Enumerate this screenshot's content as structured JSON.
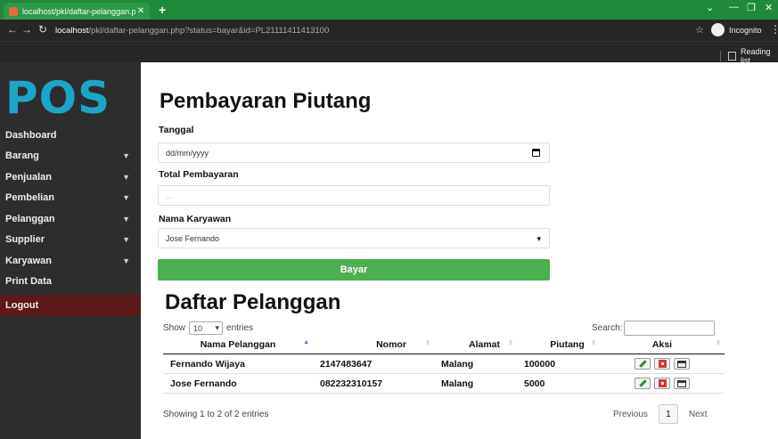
{
  "browser": {
    "tab_title": "localhost/pkl/daftar-pelanggan.p",
    "url_host": "localhost",
    "url_path": "/pkl/daftar-pelanggan.php?status=bayar&id=PL21111411413100",
    "incognito_label": "Incognito",
    "reading_list_label": "Reading list"
  },
  "sidebar": {
    "logo": "POS",
    "items": [
      {
        "label": "Dashboard",
        "has_caret": false
      },
      {
        "label": "Barang",
        "has_caret": true
      },
      {
        "label": "Penjualan",
        "has_caret": true
      },
      {
        "label": "Pembelian",
        "has_caret": true
      },
      {
        "label": "Pelanggan",
        "has_caret": true
      },
      {
        "label": "Supplier",
        "has_caret": true
      },
      {
        "label": "Karyawan",
        "has_caret": true
      },
      {
        "label": "Print Data",
        "has_caret": false
      }
    ],
    "logout": "Logout"
  },
  "form": {
    "title": "Pembayaran Piutang",
    "tanggal_label": "Tanggal",
    "tanggal_placeholder": "dd/mm/yyyy",
    "total_label": "Total Pembayaran",
    "total_placeholder": "...",
    "karyawan_label": "Nama Karyawan",
    "karyawan_value": "Jose Fernando",
    "submit_label": "Bayar"
  },
  "table": {
    "title": "Daftar Pelanggan",
    "show_label": "Show",
    "show_value": "10",
    "entries_label": "entries",
    "search_label": "Search:",
    "columns": [
      "Nama Pelanggan",
      "Nomor",
      "Alamat",
      "Piutang",
      "Aksi"
    ],
    "rows": [
      {
        "nama": "Fernando Wijaya",
        "nomor": "2147483647",
        "alamat": "Malang",
        "piutang": "100000"
      },
      {
        "nama": "Jose Fernando",
        "nomor": "082232310157",
        "alamat": "Malang",
        "piutang": "5000"
      }
    ],
    "info": "Showing 1 to 2 of 2 entries",
    "prev_label": "Previous",
    "page_number": "1",
    "next_label": "Next"
  },
  "colors": {
    "accent_green": "#4caf50",
    "logo_blue": "#1aa6c8",
    "sidebar_bg": "#2d2d2d",
    "logout_bg": "#5a1a1a",
    "browser_green": "#1e8a3a"
  }
}
